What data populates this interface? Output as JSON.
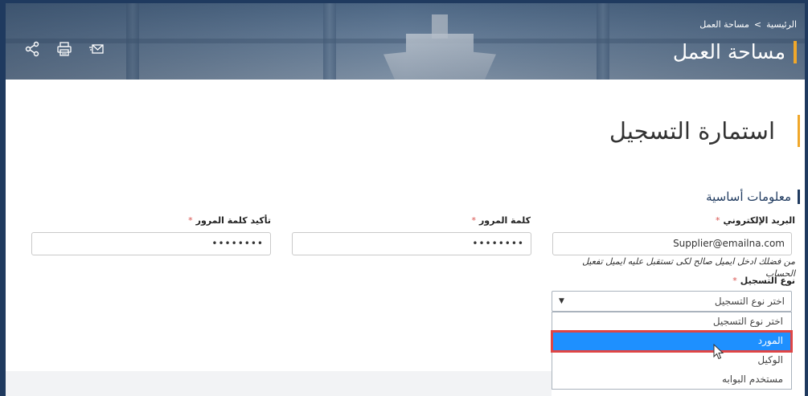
{
  "breadcrumb": {
    "home": "الرئيسية",
    "separator": ">",
    "current": "مساحة العمل"
  },
  "header": {
    "title": "مساحة العمل",
    "icons": [
      "share-icon",
      "print-icon",
      "email-icon"
    ]
  },
  "form": {
    "title": "استمارة التسجيل",
    "section_title": "معلومات أساسية",
    "required_marker": "*",
    "email": {
      "label": "البريد الإلكتروني",
      "value": "Supplier@emailna.com",
      "hint": "من فضلك ادخل ايميل صالح لكى تستقبل عليه ايميل تفعيل الحساب"
    },
    "password": {
      "label": "كلمة المرور",
      "value": "••••••••"
    },
    "confirm_password": {
      "label": "تأكيد كلمة المرور",
      "value": "••••••••"
    },
    "registration_type": {
      "label": "نوع التسجيل",
      "selected": "اختر نوع التسجيل",
      "options": [
        "اختر نوع التسجيل",
        "المورد",
        "الوكيل",
        "مستخدم البوابه"
      ],
      "highlighted_index": 1
    }
  },
  "colors": {
    "accent": "#f0a72a",
    "navy": "#1f3a5f",
    "highlight": "#1e90ff",
    "highlight_border": "#e04545"
  }
}
